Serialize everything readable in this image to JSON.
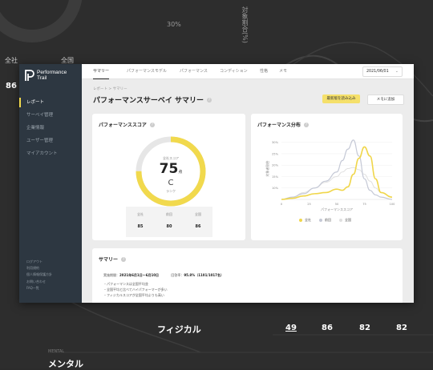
{
  "background": {
    "top_labels": [
      "全社",
      "全国"
    ],
    "left_value": "86",
    "axis_percent": "30%",
    "vertical_label": "対象割合(%)",
    "row_label": "フィジカル",
    "row_values": [
      "49",
      "86",
      "82",
      "82"
    ],
    "mental_sub": "MENTAL",
    "mental_label": "メンタル"
  },
  "app": {
    "brand": {
      "line1": "Performance",
      "line2": "Trail"
    },
    "nav": [
      {
        "label": "レポート",
        "active": true
      },
      {
        "label": "サーベイ管理"
      },
      {
        "label": "企業情報"
      },
      {
        "label": "ユーザー管理"
      },
      {
        "label": "マイアカウント"
      }
    ],
    "nav_bottom": [
      "ログアウト",
      "利用規約",
      "個人情報保護方針",
      "お問い合わせ",
      "FAQ一覧"
    ],
    "tabs": [
      "サマリー",
      "パフォーマンスモデル",
      "パフォーマンス",
      "コンディション",
      "性格",
      "メモ"
    ],
    "date_select": "2021/06/01",
    "breadcrumb": "レポート > サマリー",
    "page_title": "パフォーマンスサーベイ サマリー",
    "buttons": {
      "download": "最新版を読み込み",
      "memo": "メモに追加"
    }
  },
  "score_card": {
    "title": "パフォーマンススコア",
    "gauge_caption": "全社スコア",
    "score": "75",
    "score_unit": "点",
    "rank": "C",
    "rank_caption": "ランク",
    "score_fraction": 0.75,
    "stats": [
      {
        "label": "全社",
        "value": "85"
      },
      {
        "label": "前回",
        "value": "80"
      },
      {
        "label": "全国",
        "value": "86"
      }
    ]
  },
  "dist_card": {
    "title": "パフォーマンス分布",
    "colors": {
      "company": "#f0d64a",
      "previous": "#c5c9d6",
      "national": "#e0e0e0"
    }
  },
  "chart_data": {
    "type": "line",
    "title": "パフォーマンス分布",
    "xlabel": "パフォーマンススコア",
    "ylabel": "対象者割合",
    "x_ticks": [
      "0",
      "25",
      "50",
      "75",
      "100"
    ],
    "y_ticks": [
      "10%",
      "15%",
      "20%",
      "25%",
      "30%"
    ],
    "ylim": [
      5,
      32
    ],
    "xlim": [
      0,
      100
    ],
    "x": [
      0,
      10,
      20,
      30,
      40,
      50,
      55,
      60,
      65,
      70,
      75,
      80,
      85,
      90,
      100
    ],
    "series": [
      {
        "name": "全社",
        "color": "#f0d64a",
        "values": [
          5,
          5.5,
          6.5,
          7.5,
          8,
          9.5,
          9,
          10.5,
          16,
          23,
          28,
          24,
          14,
          8,
          6
        ]
      },
      {
        "name": "前回",
        "color": "#c5c9d6",
        "values": [
          5,
          6,
          7.5,
          10,
          13,
          17,
          22,
          27,
          31,
          24,
          14,
          9,
          7,
          6,
          5
        ]
      },
      {
        "name": "全国",
        "color": "#e0e0e0",
        "values": [
          5,
          6,
          8,
          10,
          12.5,
          15,
          17,
          18.5,
          19,
          18,
          16,
          13,
          10,
          8,
          6
        ]
      }
    ],
    "legend_position": "bottom"
  },
  "summary": {
    "title": "サマリー",
    "period_label": "実施期間：",
    "period_value": "2021年6月1日〜6月10日",
    "rate_label": "回答率：",
    "rate_value": "95.8%（1101/1017名）",
    "bullets": [
      "・パフォーマンスは全国平均並",
      "・全国平均と比べてハイパフォーマーが多い",
      "・フィジカルスコアが全国平均よりも高い"
    ]
  }
}
